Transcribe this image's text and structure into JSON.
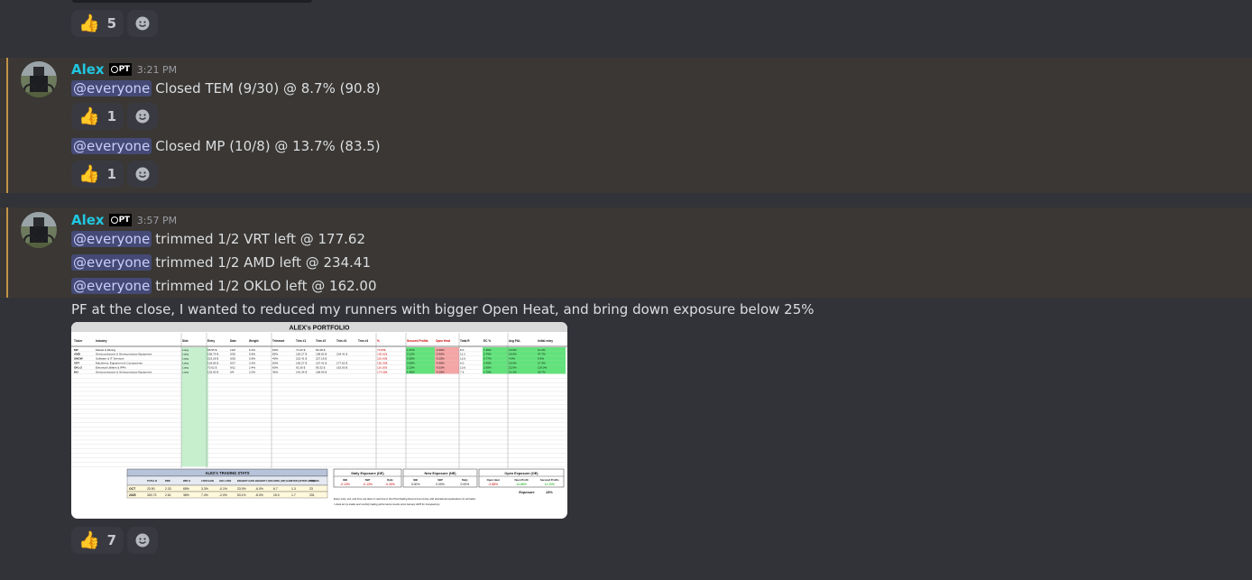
{
  "prev": {
    "thumb_count": "5"
  },
  "msg1": {
    "author": "Alex",
    "tag": "PT",
    "time": "3:21 PM",
    "line1_mention": "@everyone",
    "line1_text": "Closed TEM (9/30)  @ 8.7% (90.8)",
    "line1_thumb": "1",
    "line2_mention": "@everyone",
    "line2_text": "Closed MP (10/8)  @ 13.7% (83.5)",
    "line2_thumb": "1"
  },
  "msg2": {
    "author": "Alex",
    "tag": "PT",
    "time": "3:57 PM",
    "lines": [
      {
        "mention": "@everyone",
        "text": "trimmed 1/2 VRT left @ 177.62"
      },
      {
        "mention": "@everyone",
        "text": "trimmed 1/2 AMD left @ 234.41"
      },
      {
        "mention": "@everyone",
        "text": "trimmed 1/2 OKLO left @ 162.00"
      }
    ],
    "pf_text": "PF at the close, I wanted to reduced my runners with bigger Open Heat, and bring down exposure below 25%",
    "thumb_count": "7"
  },
  "portfolio": {
    "title": "ALEX's PORTFOLIO",
    "headers": [
      "Ticker",
      "Industry",
      "Side",
      "Entry",
      "Date",
      "Weight",
      "Trimmed",
      "Trim #1",
      "Trim #2",
      "Trim #3",
      "Trim #4",
      "%",
      "Secured Profits",
      "Open Heat",
      "Total R",
      "EC %",
      "Avg P&L",
      "Initial entry"
    ],
    "rows": [
      [
        "MP",
        "Metals & Mining",
        "Long",
        "68.55 $",
        "12/2",
        "6.2%",
        "60%",
        "71.02 $",
        "80.48 $",
        "",
        "",
        "79.85$",
        "1.87%",
        "-0.48%",
        "8.0",
        "1.36%",
        "13.0%",
        "11.2%"
      ],
      [
        "AMD",
        "Semiconductors & Semiconductor Equipment",
        "Long",
        "158.79 $",
        "9/25",
        "5.8%",
        "85%",
        "182.27 $",
        "198.83 $",
        "234.41 $",
        "",
        "195.81$",
        "2.12%",
        "-0.46%",
        "11.2",
        "2.79%",
        "18.0%",
        "47.7%"
      ],
      [
        "SNOW",
        "Software & IT Services",
        "Long",
        "219.28 $",
        "9/25",
        "5.8%",
        "40%",
        "222.41 $",
        "227.18 $",
        "",
        "",
        "220.60$",
        "0.56%",
        "-0.25%",
        "12.6",
        "0.77%",
        "4.9%",
        "9.6%"
      ],
      [
        "VRT",
        "Machinery, Equipment & Components",
        "Long",
        "129.85 $",
        "9/17",
        "2.5%",
        "60%",
        "150.27 $",
        "167.41 $",
        "177.62 $",
        "",
        "156.30$",
        "3.05%",
        "-0.48%",
        "6.0",
        "2.49%",
        "16.0%",
        "17.3%"
      ],
      [
        "OKLO",
        "Electrical Utilities & IPPs",
        "Long",
        "73.62 $",
        "9/11",
        "2.4%",
        "60%",
        "92.30 $",
        "95.32 $",
        "162.00 $",
        "",
        "116.30$",
        "2.23%",
        "-0.53%",
        "13.6",
        "2.69%",
        "22.0%",
        "119.0%"
      ],
      [
        "MU",
        "Semiconductors & Semiconductor Equipment",
        "Long",
        "125.90 $",
        "9/4",
        "2.0%",
        "45%",
        "142.34 $",
        "168.99 $",
        "",
        "",
        "174.58$",
        "1.48%",
        "-0.39%",
        "7.6",
        "1.79%",
        "21.3%",
        "35.7%"
      ]
    ],
    "stats_title": "ALEX's TRADING STATS",
    "stats_headers": [
      "",
      "TOTAL R",
      "RRR",
      "WIN %",
      "# R/R GAIN",
      "AVG LOSS",
      "BIGGEST GAIN",
      "BIGGEST LOSS",
      "AVRG (HP) GAIN",
      "# R/R (AFTER LOSS)",
      "TRADES"
    ],
    "stats_rows": [
      [
        "OCT",
        "23.90",
        "2.33",
        "65%",
        "3.3%",
        "-0.1%",
        "23.0%",
        "-6.0%",
        "6.7",
        "1.3",
        "23"
      ],
      [
        "2025",
        "300.73",
        "2.61",
        "38%",
        "7.4%",
        "-2.0%",
        "53.1%",
        "-8.0%",
        "15.0",
        "1.7",
        "331"
      ]
    ],
    "daily_exposure": {
      "title": "Daily Exposure (DE)",
      "labels": [
        "IBB",
        "SBP",
        "Daily"
      ],
      "values": [
        "-0.13%",
        "-0.13%",
        "-0.26%"
      ]
    },
    "new_exposure": {
      "title": "New Exposure (NE)",
      "labels": [
        "IBB",
        "SBP",
        "Daily"
      ],
      "values": [
        "0.00%",
        "0.00%",
        "0.00%"
      ]
    },
    "open_exposure": {
      "title": "Open Exposure (OE)",
      "labels": [
        "Open Heat",
        "Open Profit",
        "Secured Profits"
      ],
      "values": [
        "-2.88%",
        "14.86%",
        "11.10%"
      ]
    },
    "exposure_label": "Exposure",
    "exposure_value": "23%",
    "note1": "Every entry, exit, and trims are taken in real time in the PrimeTrading Discord community, with educational explanations for all trades.",
    "note2": "I share all my trades and monthly trading performance results since January 2025 for transparency."
  }
}
